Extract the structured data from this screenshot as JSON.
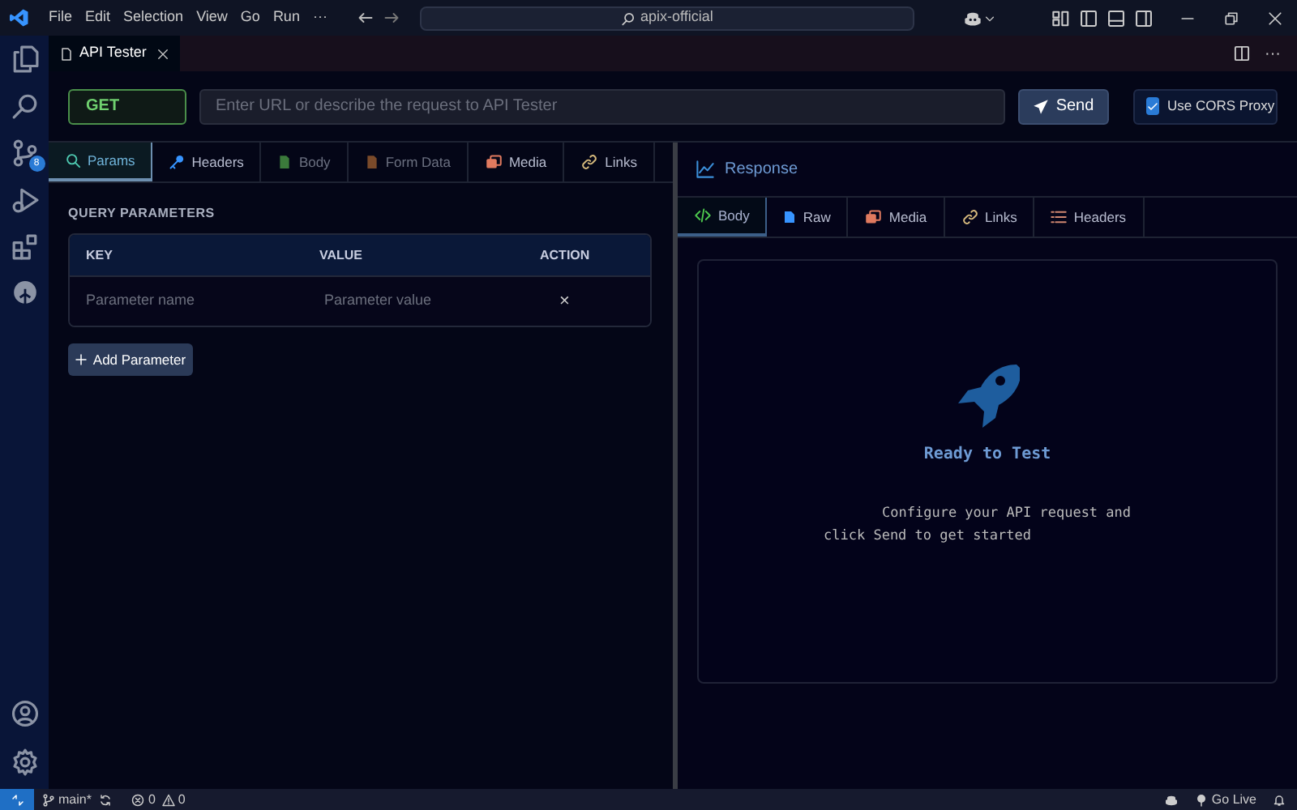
{
  "menu": [
    "File",
    "Edit",
    "Selection",
    "View",
    "Go",
    "Run",
    "···"
  ],
  "command_center": {
    "text": "apix-official"
  },
  "activity_bar": {
    "badge": "8"
  },
  "editor_tab": {
    "title": "API Tester",
    "selected": true,
    "more_actions": "···"
  },
  "request": {
    "method": "GET",
    "url_placeholder": "Enter URL or describe the request to API Tester",
    "send_label": "Send",
    "cors": {
      "label": "Use CORS Proxy",
      "checked": true
    }
  },
  "request_tabs": [
    {
      "label": "Params",
      "kind": "search",
      "selected": true,
      "disabled": false
    },
    {
      "label": "Headers",
      "kind": "key",
      "selected": false,
      "disabled": false
    },
    {
      "label": "Body",
      "kind": "doc",
      "selected": false,
      "disabled": true
    },
    {
      "label": "Form Data",
      "kind": "form",
      "selected": false,
      "disabled": true
    },
    {
      "label": "Media",
      "kind": "media",
      "selected": false,
      "disabled": false
    },
    {
      "label": "Links",
      "kind": "link",
      "selected": false,
      "disabled": false
    }
  ],
  "query_parameters": {
    "title": "QUERY PARAMETERS",
    "columns": [
      "KEY",
      "VALUE",
      "ACTION"
    ],
    "rows": [
      {
        "key_placeholder": "Parameter name",
        "value_placeholder": "Parameter value",
        "action": "×"
      }
    ],
    "add_label": "Add Parameter"
  },
  "response": {
    "title": "Response",
    "tabs": [
      {
        "label": "Body",
        "kind": "code",
        "selected": true
      },
      {
        "label": "Raw",
        "kind": "file",
        "selected": false
      },
      {
        "label": "Media",
        "kind": "media",
        "selected": false
      },
      {
        "label": "Links",
        "kind": "link",
        "selected": false
      },
      {
        "label": "Headers",
        "kind": "list",
        "selected": false
      }
    ],
    "empty_title": "Ready to Test",
    "empty_message": "Configure your API request and click Send to get started"
  },
  "status_bar": {
    "branch": "main*",
    "errors": "0",
    "warnings": "0",
    "go_live": "Go Live"
  }
}
